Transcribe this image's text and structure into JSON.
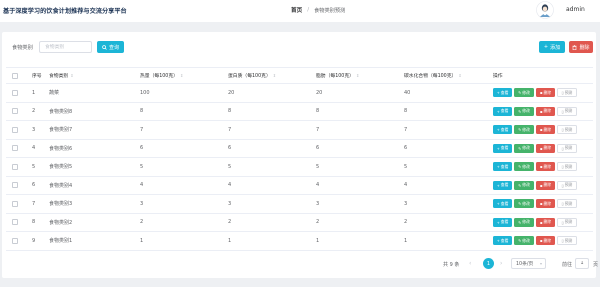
{
  "header": {
    "app_title": "基于深度学习的饮食计划推荐与交流分享平台",
    "breadcrumb_home": "首页",
    "breadcrumb_separator": "/",
    "breadcrumb_current": "食物类别预测",
    "username": "admin"
  },
  "filter": {
    "label": "食物类别",
    "placeholder": "食物类别",
    "value": "",
    "search_button": "查询"
  },
  "toolbar": {
    "add_button": "添加",
    "delete_button": "删除"
  },
  "table": {
    "columns": [
      "序号",
      "食物类别",
      "热量（每100克）",
      "蛋白质（每100克）",
      "脂肪（每100克）",
      "碳水化合物（每100克）",
      "操作"
    ],
    "row_actions": {
      "view": "查看",
      "edit": "修改",
      "delete": "删除",
      "predict": "预测"
    },
    "rows": [
      [
        "1",
        "蔬菜",
        "100",
        "20",
        "20",
        "40"
      ],
      [
        "2",
        "食物类别8",
        "8",
        "8",
        "8",
        "8"
      ],
      [
        "3",
        "食物类别7",
        "7",
        "7",
        "7",
        "7"
      ],
      [
        "4",
        "食物类别6",
        "6",
        "6",
        "6",
        "6"
      ],
      [
        "5",
        "食物类别5",
        "5",
        "5",
        "5",
        "5"
      ],
      [
        "6",
        "食物类别4",
        "4",
        "4",
        "4",
        "4"
      ],
      [
        "7",
        "食物类别3",
        "3",
        "3",
        "3",
        "3"
      ],
      [
        "8",
        "食物类别2",
        "2",
        "2",
        "2",
        "2"
      ],
      [
        "9",
        "食物类别1",
        "1",
        "1",
        "1",
        "1"
      ]
    ]
  },
  "pagination": {
    "total": "共 9 条",
    "current_page": "1",
    "page_size": "10条/页",
    "goto_label": "前往",
    "goto_value": "1",
    "goto_unit": "页"
  },
  "colors": {
    "primary": "#1cb5d6",
    "success": "#45b36b",
    "danger": "#e0574f",
    "title": "#1e3556"
  },
  "icons": {
    "search": "search-icon",
    "add": "plus-icon",
    "delete": "trash-icon",
    "edit": "edit-icon",
    "predict": "document-icon",
    "avatar": "user-avatar-icon"
  }
}
